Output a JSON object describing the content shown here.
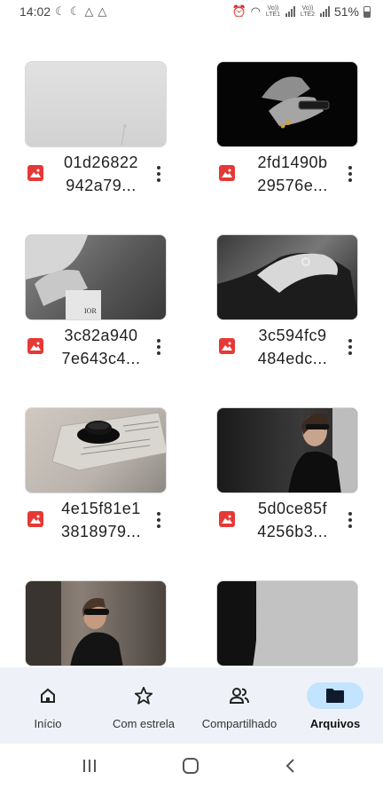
{
  "status_bar": {
    "time": "14:02",
    "battery": "51%",
    "sim1_label": "Vo)) LTE1",
    "sim2_label": "Vo)) LTE2"
  },
  "files": [
    {
      "name_line1": "01d26822",
      "name_line2": "942a79...",
      "thumbnail": "foggy-gray"
    },
    {
      "name_line1": "2fd1490b",
      "name_line2": "29576e...",
      "thumbnail": "hands-dark"
    },
    {
      "name_line1": "3c82a940",
      "name_line2": "7e643c4...",
      "thumbnail": "hands-magazine"
    },
    {
      "name_line1": "3c594fc9",
      "name_line2": "484edc...",
      "thumbnail": "hand-bw"
    },
    {
      "name_line1": "4e15f81e1",
      "name_line2": "3818979...",
      "thumbnail": "coffee-newspaper"
    },
    {
      "name_line1": "5d0ce85f",
      "name_line2": "4256b3...",
      "thumbnail": "woman-sunglasses"
    },
    {
      "name_line1": "",
      "name_line2": "",
      "thumbnail": "woman-street"
    },
    {
      "name_line1": "",
      "name_line2": "",
      "thumbnail": "gray-paper"
    }
  ],
  "bottom_nav": {
    "items": [
      {
        "label": "Início",
        "icon": "home-icon"
      },
      {
        "label": "Com estrela",
        "icon": "star-icon"
      },
      {
        "label": "Compartilhado",
        "icon": "people-icon"
      },
      {
        "label": "Arquivos",
        "icon": "folder-icon",
        "active": true
      }
    ]
  },
  "colors": {
    "file_icon_red": "#e53935",
    "nav_background": "#eef2f8",
    "active_pill": "#c3e4ff"
  }
}
